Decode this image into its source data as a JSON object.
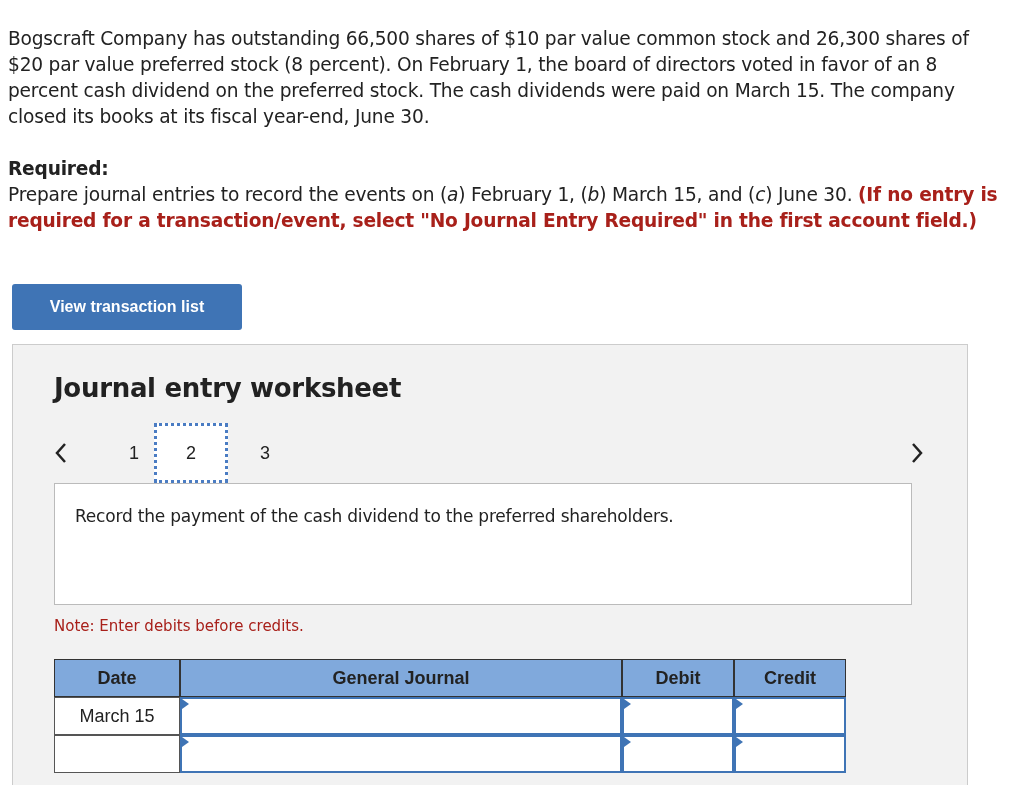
{
  "problem": "Bogscraft Company has outstanding 66,500 shares of $10 par value common stock and 26,300 shares of $20 par value preferred stock (8 percent). On February 1, the board of directors voted in favor of an 8 percent cash dividend on the preferred stock. The cash dividends were paid on March 15. The company closed its books at its fiscal year-end, June 30.",
  "required_label": "Required:",
  "instruction": "Prepare journal entries to record the events on (*a*) February 1, (*b*) March 15, and (*c*) June 30.",
  "instruction_note": "(If no entry is required for a transaction/event, select \"No Journal Entry Required\" in the first account field.)",
  "view_button": "View transaction list",
  "worksheet": {
    "title": "Journal entry worksheet",
    "steps": [
      {
        "label": "1",
        "selected": false
      },
      {
        "label": "2",
        "selected": true
      },
      {
        "label": "3",
        "selected": false
      }
    ],
    "prompt": "Record the payment of the cash dividend to the preferred shareholders.",
    "note": "Note: Enter debits before credits.",
    "table": {
      "columns": [
        "Date",
        "General Journal",
        "Debit",
        "Credit"
      ],
      "rows": [
        {
          "date": "March 15"
        },
        {}
      ]
    }
  }
}
